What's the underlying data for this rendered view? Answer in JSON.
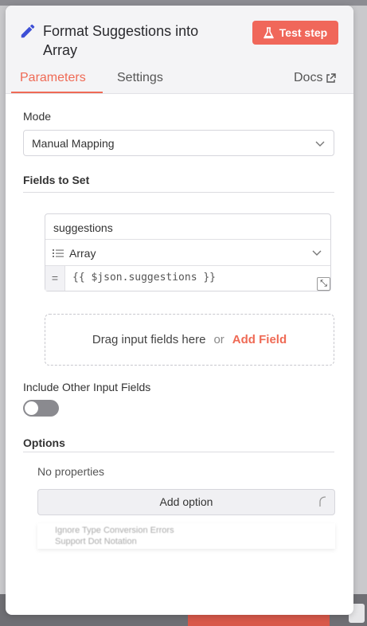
{
  "header": {
    "title": "Format Suggestions into Array",
    "test_button": "Test step",
    "tabs": [
      "Parameters",
      "Settings"
    ],
    "docs_label": "Docs"
  },
  "mode": {
    "label": "Mode",
    "value": "Manual Mapping"
  },
  "fields": {
    "label": "Fields to Set",
    "name_value": "suggestions",
    "type_value": "Array",
    "value_expr": "{{ $json.suggestions }}"
  },
  "dropzone": {
    "text": "Drag input fields here",
    "or": "or",
    "add_field": "Add Field"
  },
  "include": {
    "label": "Include Other Input Fields",
    "enabled": false
  },
  "options": {
    "label": "Options",
    "empty_text": "No properties",
    "add_option": "Add option",
    "dropdown_items": [
      "Ignore Type Conversion Errors",
      "Support Dot Notation"
    ]
  },
  "colors": {
    "accent": "#ef6a55",
    "test_button_bg": "#f0675a",
    "pencil_icon": "#3d4fd6"
  }
}
